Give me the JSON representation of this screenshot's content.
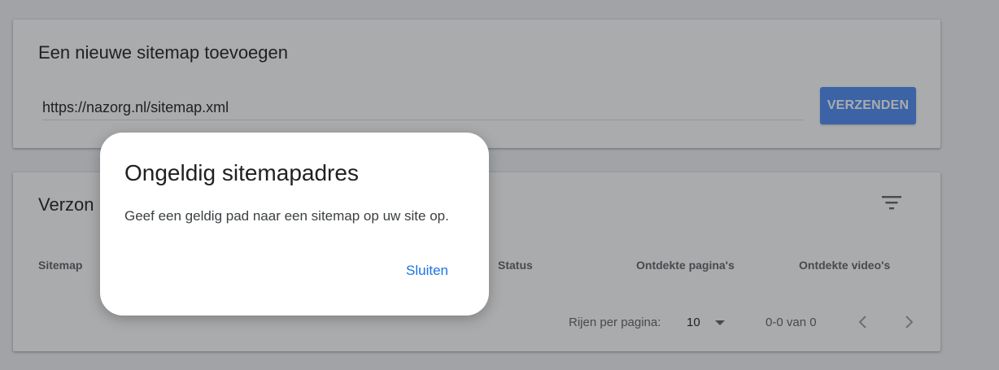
{
  "add_card": {
    "title": "Een nieuwe sitemap toevoegen",
    "input_value": "https://nazorg.nl/sitemap.xml",
    "submit_label": "VERZENDEN"
  },
  "list_card": {
    "title": "Verzon",
    "filter_icon": "filter-icon",
    "columns": {
      "sitemap": "Sitemap",
      "status": "Status",
      "pages": "Ontdekte pagina's",
      "videos": "Ontdekte video's"
    },
    "pagination": {
      "rows_label": "Rijen per pagina:",
      "rows_value": "10",
      "range": "0-0 van 0",
      "prev_icon": "chevron-left-icon",
      "next_icon": "chevron-right-icon"
    }
  },
  "dialog": {
    "title": "Ongeldig sitemapadres",
    "message": "Geef een geldig pad naar een sitemap op uw site op.",
    "close_label": "Sluiten"
  },
  "colors": {
    "accent": "#4c8bf5",
    "link": "#1a73e8",
    "overlay": "rgba(32,33,36,0.38)"
  }
}
